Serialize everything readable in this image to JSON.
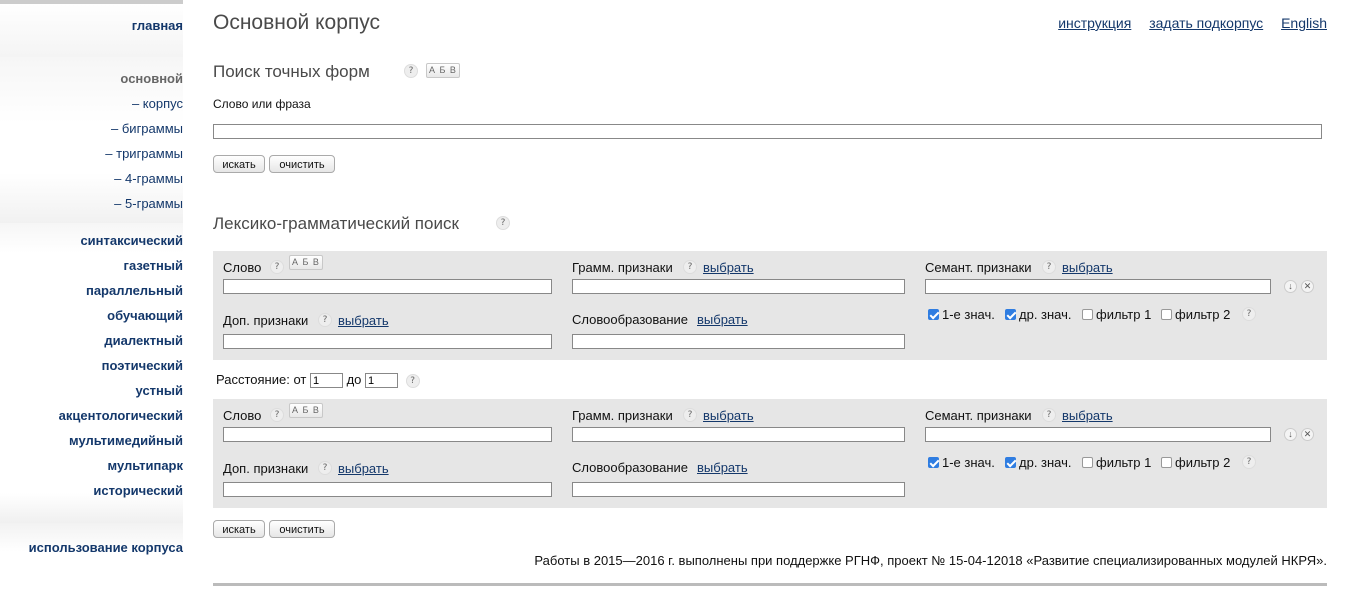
{
  "sidebar": {
    "home": "главная",
    "main_current": "основной",
    "sub_items": [
      "– корпус",
      "– биграммы",
      "– триграммы",
      "– 4-граммы",
      "– 5-граммы"
    ],
    "corpora": [
      "синтаксический",
      "газетный",
      "параллельный",
      "обучающий",
      "диалектный",
      "поэтический",
      "устный",
      "акцентологический",
      "мультимедийный",
      "мультипарк",
      "исторический"
    ],
    "usage": "использование корпуса"
  },
  "header": {
    "title": "Основной корпус",
    "links": [
      "инструкция",
      "задать подкорпус",
      "English"
    ]
  },
  "exact_search": {
    "title": "Поиск точных форм",
    "help": "?",
    "abv": "А Б В",
    "field_label": "Слово или фраза",
    "field_value": "",
    "search_button": "искать",
    "clear_button": "очистить"
  },
  "lexgram": {
    "title": "Лексико-грамматический поиск",
    "help": "?",
    "blocks": [
      {
        "word_label": "Слово",
        "gram_label": "Грамм. признаки",
        "sem_label": "Семант. признаки",
        "extra_label": "Доп. признаки",
        "deriv_label": "Словообразование",
        "choose": "выбрать",
        "options": [
          {
            "label": "1-е знач.",
            "checked": true
          },
          {
            "label": "др. знач.",
            "checked": true
          },
          {
            "label": "фильтр 1",
            "checked": false
          },
          {
            "label": "фильтр 2",
            "checked": false
          }
        ]
      },
      {
        "word_label": "Слово",
        "gram_label": "Грамм. признаки",
        "sem_label": "Семант. признаки",
        "extra_label": "Доп. признаки",
        "deriv_label": "Словообразование",
        "choose": "выбрать",
        "options": [
          {
            "label": "1-е знач.",
            "checked": true
          },
          {
            "label": "др. знач.",
            "checked": true
          },
          {
            "label": "фильтр 1",
            "checked": false
          },
          {
            "label": "фильтр 2",
            "checked": false
          }
        ]
      }
    ],
    "distance": {
      "label_from": "Расстояние: от",
      "from": "1",
      "label_to": "до",
      "to": "1"
    },
    "search_button": "искать",
    "clear_button": "очистить"
  },
  "footer": {
    "note": "Работы в 2015—2016 г. выполнены при поддержке РГНФ, проект № 15-04-12018 «Развитие специализированных модулей НКРЯ»."
  }
}
